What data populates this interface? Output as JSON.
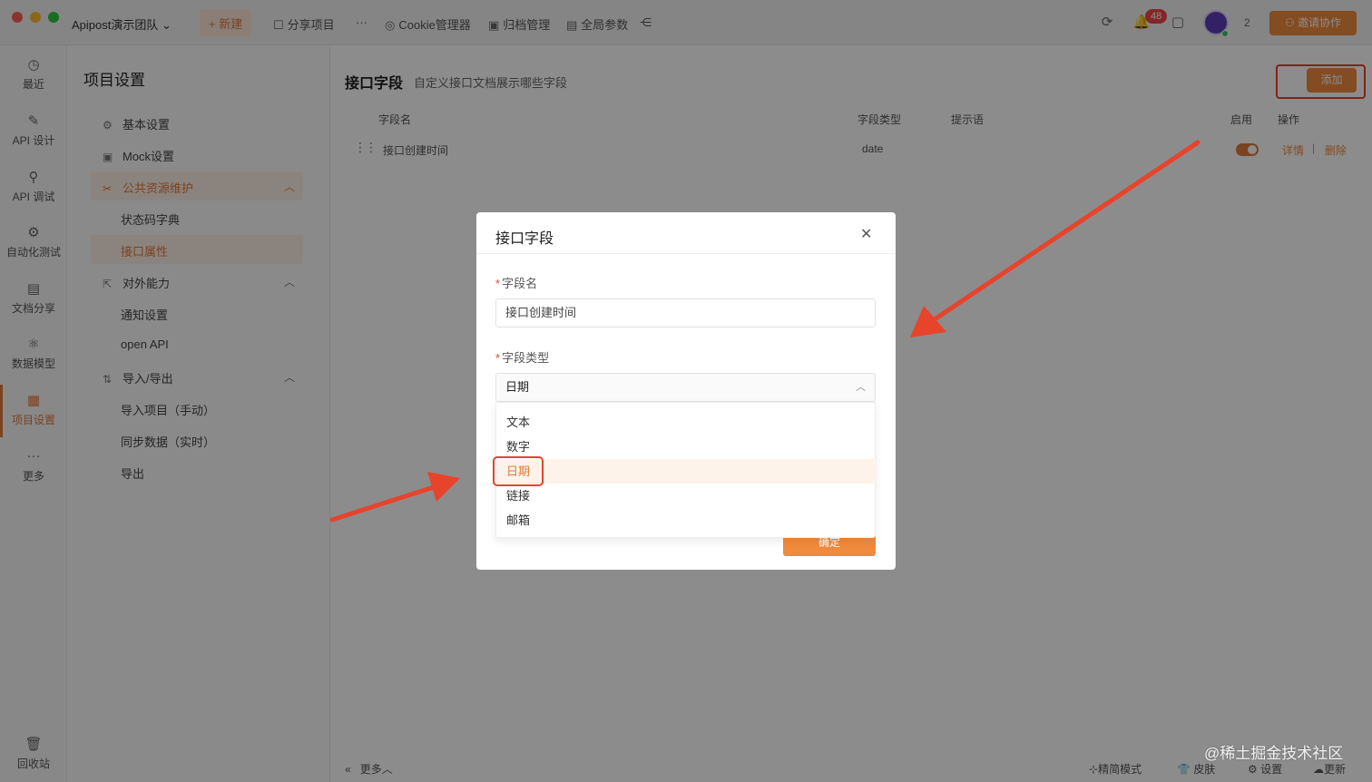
{
  "titlebar": {
    "team": "Apipost演示团队",
    "new_label": "+ 新建",
    "share": "分享项目",
    "more": "···",
    "cookie": "Cookie管理器",
    "archive": "归档管理",
    "global_params": "全局参数",
    "notif_count": "48",
    "collaborator_count": "2",
    "invite": "邀请协作"
  },
  "leftnav": {
    "items": [
      {
        "label": "最近"
      },
      {
        "label": "API 设计"
      },
      {
        "label": "API 调试"
      },
      {
        "label": "自动化测试"
      },
      {
        "label": "文档分享"
      },
      {
        "label": "数据模型"
      },
      {
        "label": "项目设置"
      },
      {
        "label": "更多"
      }
    ],
    "trash": "回收站"
  },
  "settings": {
    "title": "项目设置",
    "items": {
      "basic": "基本设置",
      "mock": "Mock设置",
      "public": "公共资源维护",
      "status_dict": "状态码字典",
      "api_attr": "接口属性",
      "external": "对外能力",
      "notify": "通知设置",
      "open_api": "open API",
      "import_export": "导入/导出",
      "import_manual": "导入项目（手动）",
      "sync_realtime": "同步数据（实时）",
      "export": "导出"
    }
  },
  "main": {
    "title": "接口字段",
    "subtitle": "自定义接口文档展示哪些字段",
    "add": "添加",
    "columns": [
      "字段名",
      "字段类型",
      "提示语",
      "启用",
      "操作"
    ],
    "row": {
      "name": "接口创建时间",
      "type": "date",
      "enabled": true,
      "detail": "详情",
      "sep": "|",
      "delete": "删除"
    }
  },
  "footer": {
    "more": "更多",
    "simple_mode": "精简模式",
    "skin": "皮肤",
    "settings": "设置",
    "update": "更新",
    "watermark": "@稀土掘金技术社区"
  },
  "modal": {
    "title": "接口字段",
    "field_name_label": "字段名",
    "field_name_value": "接口创建时间",
    "field_type_label": "字段类型",
    "field_type_value": "日期",
    "options": [
      "文本",
      "数字",
      "日期",
      "链接",
      "邮箱"
    ],
    "selected_option": "日期",
    "ok": "确定"
  },
  "colors": {
    "accent": "#f08a3c",
    "annotation": "#e8432b"
  }
}
